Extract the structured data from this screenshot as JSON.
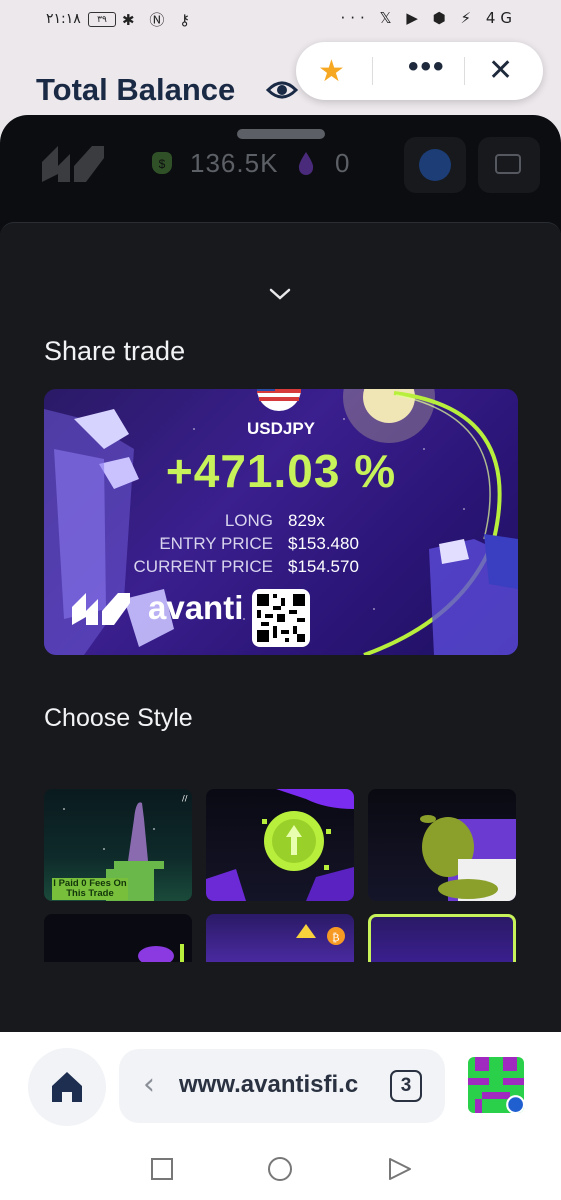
{
  "status_bar": {
    "time": "٢١:١٨",
    "battery": "٣٩",
    "right_icons": "··· 𝕏 ▶ ⬢ ⚡ 4G"
  },
  "background_page": {
    "title": "Total Balance"
  },
  "floating_menu": {
    "star_icon": "star-icon",
    "more_icon": "more-icon",
    "close_icon": "close-icon"
  },
  "app_header": {
    "coin_balance": "136.5K",
    "drop_balance": "0"
  },
  "share_sheet": {
    "heading": "Share trade",
    "card": {
      "pair": "USDJPY",
      "pnl": "+471.03 %",
      "rows": [
        {
          "label": "LONG",
          "value": "829x"
        },
        {
          "label": "ENTRY PRICE",
          "value": "$153.480"
        },
        {
          "label": "CURRENT PRICE",
          "value": "$154.570"
        }
      ],
      "brand": "avanti"
    },
    "style_heading": "Choose Style",
    "style_thumb_caption": "I Paid 0 Fees On This Trade"
  },
  "browser": {
    "url": "www.avantisfi.c",
    "tab_count": "3"
  },
  "colors": {
    "accent_green": "#c8f25a",
    "card_purple": "#3a1f8e",
    "sheet_bg": "#17191d"
  }
}
